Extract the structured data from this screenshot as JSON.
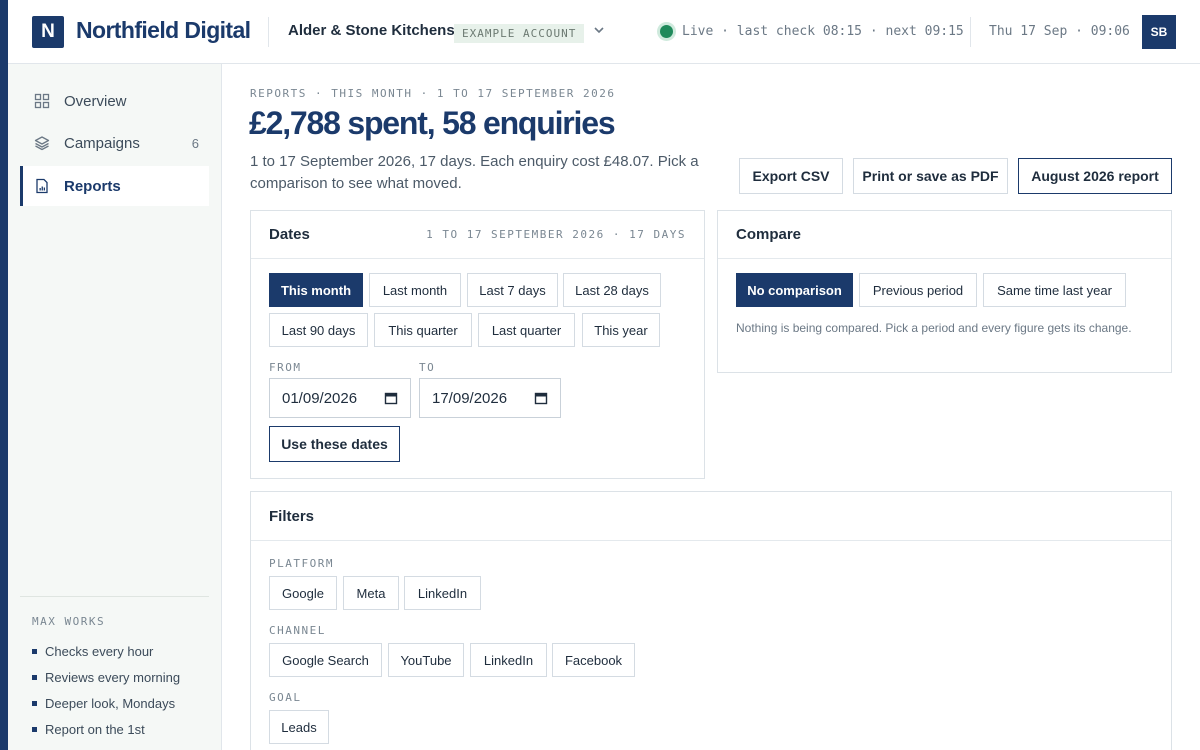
{
  "header": {
    "logo_letter": "N",
    "brand": "Northfield Digital",
    "account_name": "Alder & Stone Kitchens",
    "account_badge": "EXAMPLE ACCOUNT",
    "status": "Live · last check 08:15 · next 09:15",
    "datetime": "Thu 17 Sep · 09:06",
    "avatar": "SB"
  },
  "sidebar": {
    "items": [
      {
        "label": "Overview",
        "icon": "grid-icon"
      },
      {
        "label": "Campaigns",
        "icon": "layers-icon",
        "count": "6"
      },
      {
        "label": "Reports",
        "icon": "report-icon",
        "active": true
      }
    ],
    "works_title": "MAX WORKS",
    "works": [
      "Checks every hour",
      "Reviews every morning",
      "Deeper look, Mondays",
      "Report on the 1st"
    ]
  },
  "main": {
    "eyebrow": "REPORTS · THIS MONTH · 1 TO 17 SEPTEMBER 2026",
    "headline": "£2,788 spent, 58 enquiries",
    "summary": "1 to 17 September 2026, 17 days. Each enquiry cost £48.07. Pick a comparison to see what moved.",
    "actions": {
      "export": "Export CSV",
      "pdf": "Print or save as PDF",
      "august": "August 2026 report"
    }
  },
  "dates": {
    "title": "Dates",
    "meta": "1 TO 17 SEPTEMBER 2026 · 17 DAYS",
    "presets": [
      "This month",
      "Last month",
      "Last 7 days",
      "Last 28 days",
      "Last 90 days",
      "This quarter",
      "Last quarter",
      "This year"
    ],
    "from_label": "FROM",
    "to_label": "TO",
    "from_value": "01/09/2026",
    "to_value": "17/09/2026",
    "apply": "Use these dates"
  },
  "compare": {
    "title": "Compare",
    "options": [
      "No comparison",
      "Previous period",
      "Same time last year"
    ],
    "note": "Nothing is being compared. Pick a period and every figure gets its change."
  },
  "filters": {
    "title": "Filters",
    "platform_label": "PLATFORM",
    "platform": [
      "Google",
      "Meta",
      "LinkedIn"
    ],
    "channel_label": "CHANNEL",
    "channel": [
      "Google Search",
      "YouTube",
      "LinkedIn",
      "Facebook"
    ],
    "goal_label": "GOAL",
    "goal": [
      "Leads"
    ]
  },
  "colors": {
    "brand": "#1b3a6b",
    "live": "#1f8a5b",
    "badge_bg": "#e7f1ea"
  }
}
